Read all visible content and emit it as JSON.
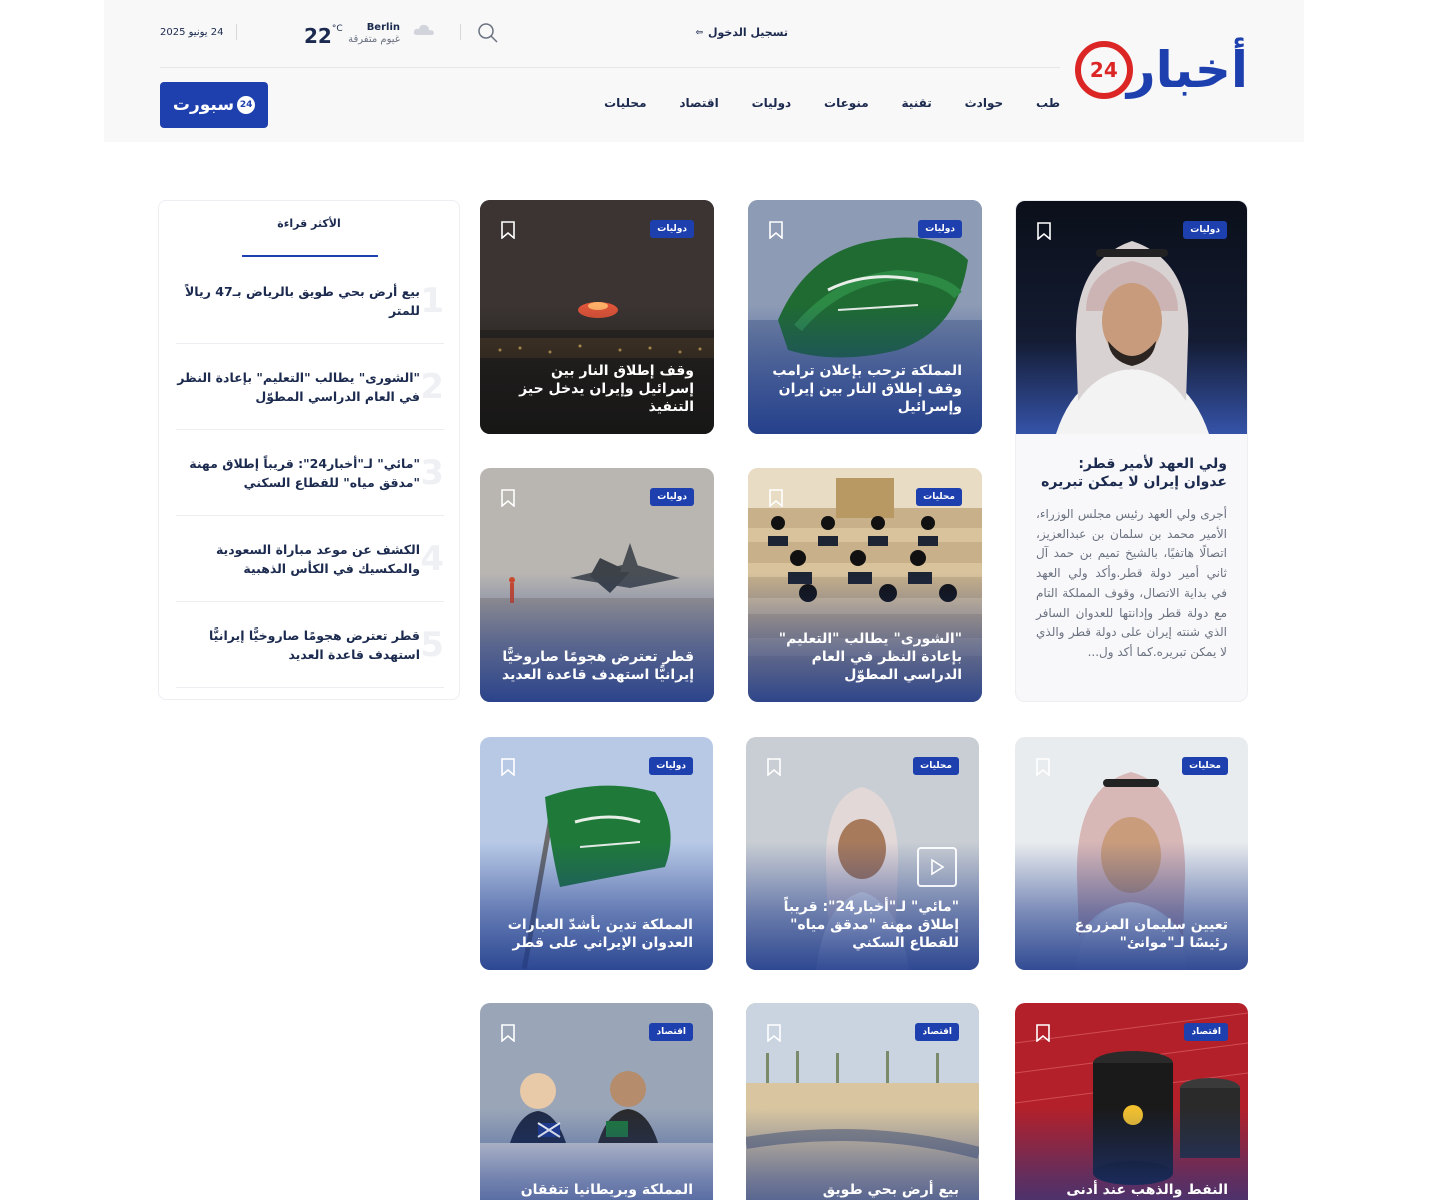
{
  "header": {
    "logo_text": "أخبار",
    "logo_badge": "24",
    "login_label": "تسجيل الدخول",
    "weather": {
      "city": "Berlin",
      "condition": "غيوم متفرقة",
      "temp": "22",
      "unit": "°C"
    },
    "date": "24 يونيو 2025",
    "nav": [
      "محليات",
      "اقتصاد",
      "دوليات",
      "منوعات",
      "تقنية",
      "حوادث",
      "طب"
    ],
    "sport_label": "سبورت",
    "sport_badge": "24"
  },
  "feature": {
    "tag": "دوليات",
    "title": "ولي العهد لأمير قطر: عدوان إيران لا يمكن تبريره",
    "excerpt": "أجرى ولي العهد رئيس مجلس الوزراء، الأمير محمد بن سلمان بن عبدالعزيز، اتصالًا هاتفيًا، بالشيخ تميم بن حمد آل ثاني أمير دولة قطر.وأكد ولي العهد في بداية الاتصال، وقوف المملكة التام مع دولة قطر وإدانتها للعدوان السافر الذي شنته إيران على دولة قطر والذي لا يمكن تبريره.كما أكد ول..."
  },
  "cards": [
    {
      "tag": "دوليات",
      "title": "المملكة ترحب بإعلان ترامب وقف إطلاق النار بين إيران وإسرائيل"
    },
    {
      "tag": "دوليات",
      "title": "وقف إطلاق النار بين إسرائيل وإيران يدخل حيز التنفيذ"
    },
    {
      "tag": "محليات",
      "title": "\"الشورى\" يطالب \"التعليم\" بإعادة النظر في العام الدراسي المطوّل"
    },
    {
      "tag": "دوليات",
      "title": "قطر تعترض هجومًا صاروخيًّا إيرانيًّا استهدف قاعدة العديد"
    },
    {
      "tag": "محليات",
      "title": "تعيين سليمان المزروع رئيسًا لـ\"موانئ\""
    },
    {
      "tag": "محليات",
      "title": "\"مائي\" لـ\"أخبار24\": قريباً إطلاق مهنة \"مدقق مياه\" للقطاع السكني"
    },
    {
      "tag": "دوليات",
      "title": "المملكة تدين بأشدّ العبارات العدوان الإيراني على قطر"
    },
    {
      "tag": "اقتصاد",
      "title": "النفط والذهب عند أدنى مستوى"
    },
    {
      "tag": "اقتصاد",
      "title": "بيع أرض بحي طويق بالرياض"
    },
    {
      "tag": "اقتصاد",
      "title": "المملكة وبريطانيا تتفقان على"
    }
  ],
  "most_read": {
    "heading": "الأكثر قراءة",
    "items": [
      {
        "num": "1",
        "title": "بيع أرض بحي طويق بالرياض بـ47 ريالاً للمتر"
      },
      {
        "num": "2",
        "title": "\"الشورى\" يطالب \"التعليم\" بإعادة النظر في العام الدراسي المطوّل"
      },
      {
        "num": "3",
        "title": "\"مائي\" لـ\"أخبار24\": قريباً إطلاق مهنة \"مدقق مياه\" للقطاع السكني"
      },
      {
        "num": "4",
        "title": "الكشف عن موعد مباراة السعودية والمكسيك في الكأس الذهبية"
      },
      {
        "num": "5",
        "title": "قطر تعترض هجومًا صاروخيًّا إيرانيًّا استهدف قاعدة العديد"
      }
    ]
  },
  "colors": {
    "brand": "#1e40af",
    "accent": "#dc2626",
    "text": "#1b2a4e"
  },
  "icons": [
    "login-icon",
    "search-icon",
    "cloud-icon",
    "bookmark-icon",
    "play-icon"
  ]
}
